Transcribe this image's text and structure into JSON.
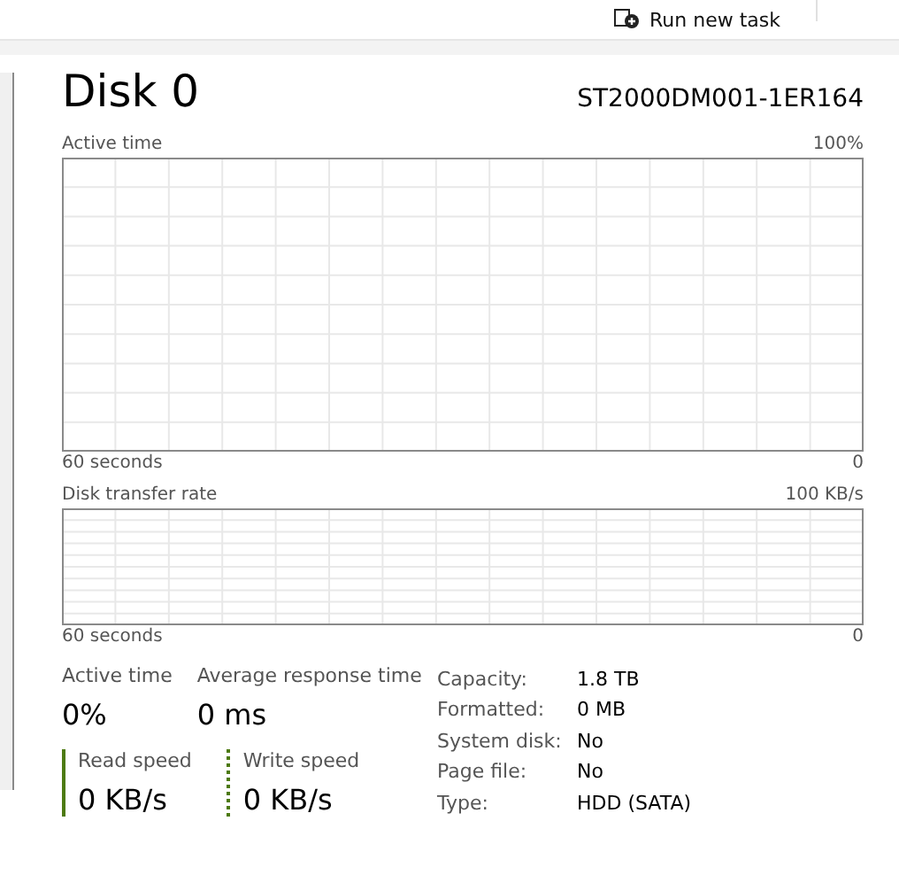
{
  "toolbar": {
    "run_new_task": "Run new task"
  },
  "disk": {
    "title": "Disk 0",
    "model": "ST2000DM001-1ER164"
  },
  "graphs": [
    {
      "label": "Active time",
      "max": "100%",
      "time_span": "60 seconds",
      "min": "0"
    },
    {
      "label": "Disk transfer rate",
      "max": "100 KB/s",
      "time_span": "60 seconds",
      "min": "0"
    }
  ],
  "stats": [
    {
      "label": "Active time",
      "value": "0%"
    },
    {
      "label": "Average response time",
      "value": "0 ms"
    }
  ],
  "speeds": [
    {
      "label": "Read speed",
      "value": "0 KB/s",
      "kind": "solid"
    },
    {
      "label": "Write speed",
      "value": "0 KB/s",
      "kind": "dotted"
    }
  ],
  "properties": [
    {
      "label": "Capacity:",
      "value": "1.8 TB"
    },
    {
      "label": "Formatted:",
      "value": "0 MB"
    },
    {
      "label": "System disk:",
      "value": "No"
    },
    {
      "label": "Page file:",
      "value": "No"
    },
    {
      "label": "Type:",
      "value": "HDD (SATA)"
    }
  ]
}
